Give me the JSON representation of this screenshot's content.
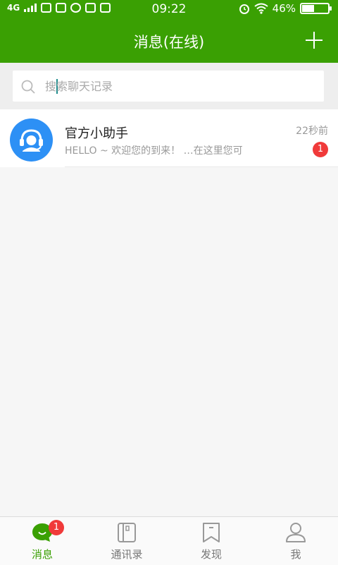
{
  "status_bar": {
    "network": "4G",
    "time": "09:22",
    "battery": "46%",
    "battery_level": 0.46
  },
  "header": {
    "title": "消息(在线)",
    "add_icon": "plus-icon"
  },
  "search": {
    "placeholder": "搜索聊天记录",
    "value": ""
  },
  "conversations": [
    {
      "name": "官方小助手",
      "preview": "HELLO ~ 欢迎您的到来！ …在这里您可",
      "time": "22秒前",
      "unread": "1",
      "avatar_icon": "customer-service-headset-icon"
    }
  ],
  "tabs": [
    {
      "label": "消息",
      "icon": "chat-bubble-icon",
      "badge": "1",
      "active": true
    },
    {
      "label": "通讯录",
      "icon": "contacts-book-icon"
    },
    {
      "label": "发现",
      "icon": "bookmark-icon"
    },
    {
      "label": "我",
      "icon": "user-icon"
    }
  ],
  "colors": {
    "primary": "#3aa003",
    "badge": "#f03a3a",
    "avatar_bg": "#2d90f5"
  }
}
